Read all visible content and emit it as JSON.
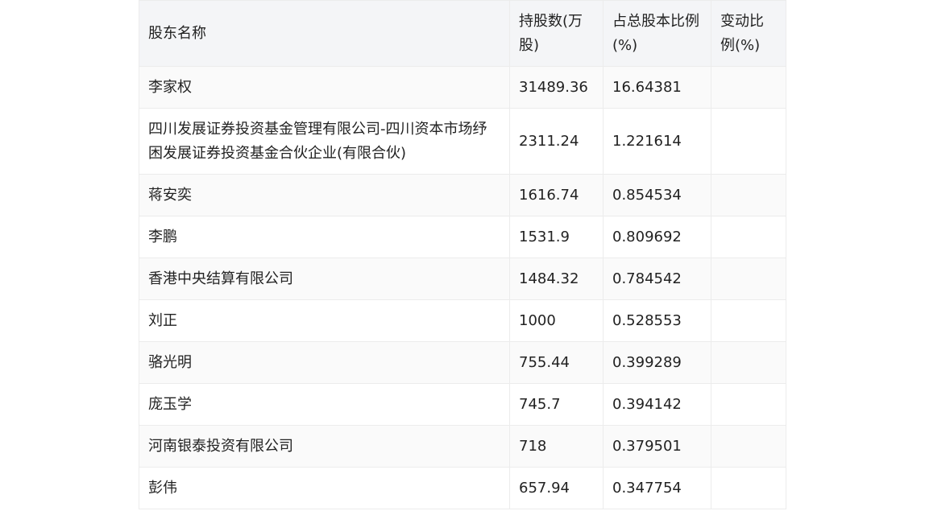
{
  "table": {
    "headers": [
      "股东名称",
      "持股数(万股)",
      "占总股本比例(%)",
      "变动比例(%)"
    ],
    "rows": [
      [
        "李家权",
        "31489.36",
        "16.64381",
        ""
      ],
      [
        "四川发展证券投资基金管理有限公司-四川资本市场纾困发展证券投资基金合伙企业(有限合伙)",
        "2311.24",
        "1.221614",
        ""
      ],
      [
        "蒋安奕",
        "1616.74",
        "0.854534",
        ""
      ],
      [
        "李鹏",
        "1531.9",
        "0.809692",
        ""
      ],
      [
        "香港中央结算有限公司",
        "1484.32",
        "0.784542",
        ""
      ],
      [
        "刘正",
        "1000",
        "0.528553",
        ""
      ],
      [
        "骆光明",
        "755.44",
        "0.399289",
        ""
      ],
      [
        "庞玉学",
        "745.7",
        "0.394142",
        ""
      ],
      [
        "河南银泰投资有限公司",
        "718",
        "0.379501",
        ""
      ],
      [
        "彭伟",
        "657.94",
        "0.347754",
        ""
      ]
    ]
  }
}
